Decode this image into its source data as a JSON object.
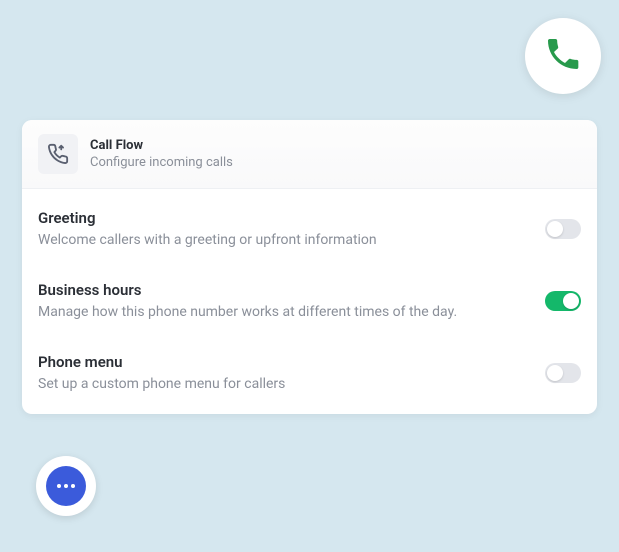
{
  "header": {
    "title": "Call Flow",
    "subtitle": "Configure incoming calls"
  },
  "rows": [
    {
      "title": "Greeting",
      "desc": "Welcome callers with a greeting or upfront information",
      "on": false
    },
    {
      "title": "Business hours",
      "desc": "Manage how this phone number works at different times of the day.",
      "on": true
    },
    {
      "title": "Phone menu",
      "desc": "Set up a custom phone menu for callers",
      "on": false
    }
  ]
}
